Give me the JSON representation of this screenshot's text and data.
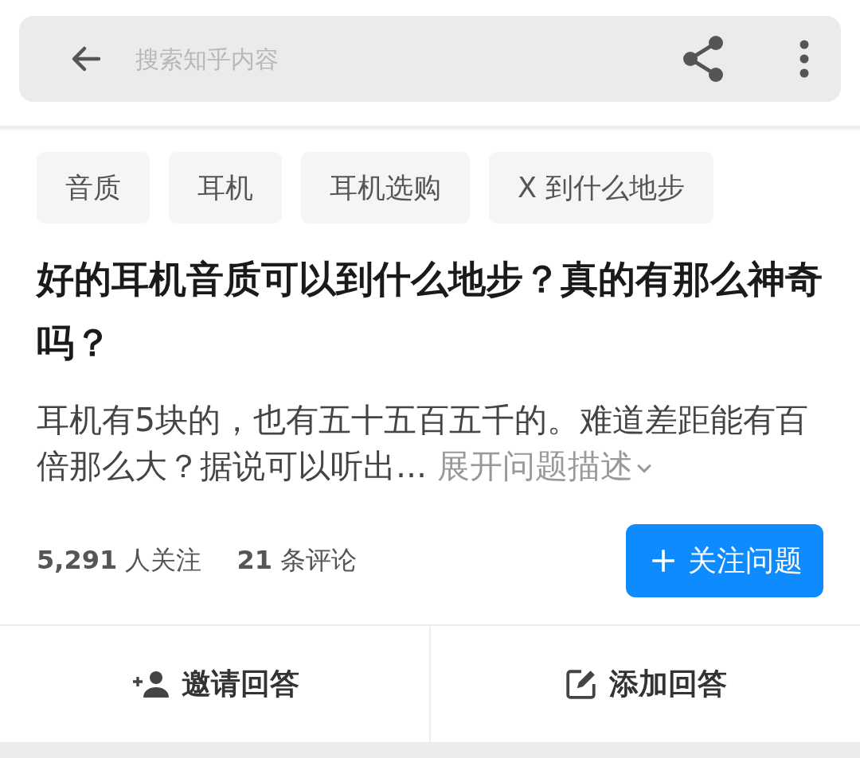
{
  "search": {
    "placeholder": "搜索知乎内容"
  },
  "tags": [
    "音质",
    "耳机",
    "耳机选购",
    "X 到什么地步"
  ],
  "question": {
    "title": "好的耳机音质可以到什么地步？真的有那么神奇吗？",
    "excerpt": "耳机有5块的，也有五十五百五千的。难道差距能有百倍那么大？据说可以听出...",
    "expand": "展开问题描述"
  },
  "stats": [
    {
      "text": "**5,291** 人关注"
    },
    {
      "text": "**21** 条评论"
    }
  ],
  "follow_button": "关注问题",
  "actions": [
    {
      "kind": "invite",
      "label": "邀请回答"
    },
    {
      "kind": "write",
      "label": "添加回答"
    }
  ]
}
